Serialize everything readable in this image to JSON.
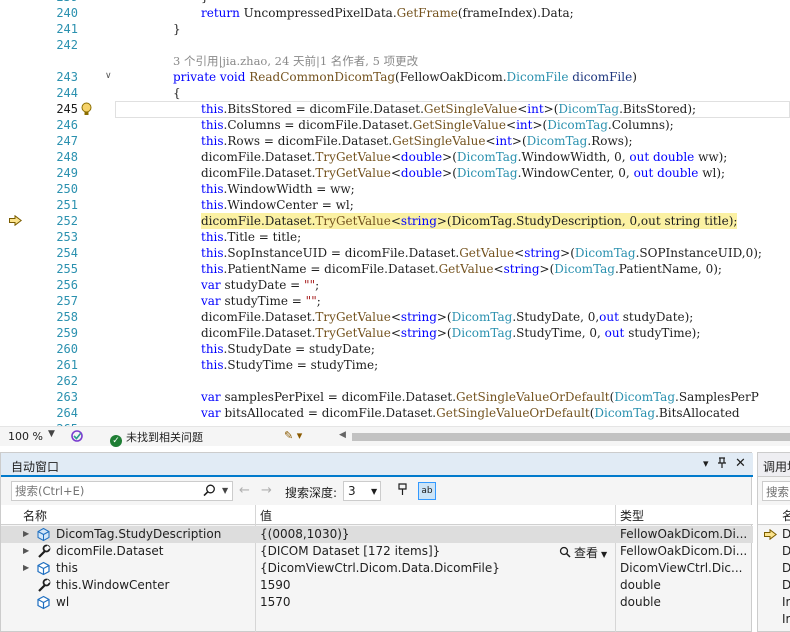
{
  "editor": {
    "lines": [
      {
        "n": "239",
        "indent": 3,
        "tokens": [
          [
            "p",
            "}"
          ]
        ]
      },
      {
        "n": "240",
        "indent": 3,
        "tokens": [
          [
            "kw",
            "return "
          ],
          [
            "p",
            "UncompressedPixelData."
          ],
          [
            "m",
            "GetFrame"
          ],
          [
            "p",
            "(frameIndex).Data;"
          ]
        ]
      },
      {
        "n": "241",
        "indent": 2,
        "tokens": [
          [
            "p",
            "}"
          ]
        ]
      },
      {
        "n": "242",
        "indent": 0,
        "tokens": []
      },
      {
        "n": "243",
        "indent": 2,
        "tokens": [
          [
            "kw",
            "private void "
          ],
          [
            "m",
            "ReadCommonDicomTag"
          ],
          [
            "p",
            "(FellowOakDicom."
          ],
          [
            "ty",
            "DicomFile"
          ],
          [
            "p",
            " "
          ],
          [
            "pl",
            "dicomFile"
          ],
          [
            "p",
            ")"
          ]
        ]
      },
      {
        "n": "244",
        "indent": 2,
        "tokens": [
          [
            "p",
            "{"
          ]
        ]
      },
      {
        "n": "245",
        "indent": 3,
        "tokens": [
          [
            "kw",
            "this"
          ],
          [
            "p",
            ".BitsStored = dicomFile.Dataset."
          ],
          [
            "m",
            "GetSingleValue"
          ],
          [
            "p",
            "<"
          ],
          [
            "kw",
            "int"
          ],
          [
            "p",
            ">("
          ],
          [
            "ty",
            "DicomTag"
          ],
          [
            "p",
            ".BitsStored);"
          ]
        ]
      },
      {
        "n": "246",
        "indent": 3,
        "tokens": [
          [
            "kw",
            "this"
          ],
          [
            "p",
            ".Columns = dicomFile.Dataset."
          ],
          [
            "m",
            "GetSingleValue"
          ],
          [
            "p",
            "<"
          ],
          [
            "kw",
            "int"
          ],
          [
            "p",
            ">("
          ],
          [
            "ty",
            "DicomTag"
          ],
          [
            "p",
            ".Columns);"
          ]
        ]
      },
      {
        "n": "247",
        "indent": 3,
        "tokens": [
          [
            "kw",
            "this"
          ],
          [
            "p",
            ".Rows = dicomFile.Dataset."
          ],
          [
            "m",
            "GetSingleValue"
          ],
          [
            "p",
            "<"
          ],
          [
            "kw",
            "int"
          ],
          [
            "p",
            ">("
          ],
          [
            "ty",
            "DicomTag"
          ],
          [
            "p",
            ".Rows);"
          ]
        ]
      },
      {
        "n": "248",
        "indent": 3,
        "tokens": [
          [
            "p",
            "dicomFile.Dataset."
          ],
          [
            "m",
            "TryGetValue"
          ],
          [
            "p",
            "<"
          ],
          [
            "kw",
            "double"
          ],
          [
            "p",
            ">("
          ],
          [
            "ty",
            "DicomTag"
          ],
          [
            "p",
            ".WindowWidth, 0, "
          ],
          [
            "kw",
            "out double "
          ],
          [
            "p",
            "ww);"
          ]
        ]
      },
      {
        "n": "249",
        "indent": 3,
        "tokens": [
          [
            "p",
            "dicomFile.Dataset."
          ],
          [
            "m",
            "TryGetValue"
          ],
          [
            "p",
            "<"
          ],
          [
            "kw",
            "double"
          ],
          [
            "p",
            ">("
          ],
          [
            "ty",
            "DicomTag"
          ],
          [
            "p",
            ".WindowCenter, 0, "
          ],
          [
            "kw",
            "out double "
          ],
          [
            "p",
            "wl);"
          ]
        ]
      },
      {
        "n": "250",
        "indent": 3,
        "tokens": [
          [
            "kw",
            "this"
          ],
          [
            "p",
            ".WindowWidth = ww;"
          ]
        ]
      },
      {
        "n": "251",
        "indent": 3,
        "tokens": [
          [
            "kw",
            "this"
          ],
          [
            "p",
            ".WindowCenter = wl;"
          ]
        ]
      },
      {
        "n": "252",
        "indent": 3,
        "highlight": true,
        "tokens": [
          [
            "p",
            "dicomFile.Dataset."
          ],
          [
            "m",
            "TryGetValue"
          ],
          [
            "p",
            "<"
          ],
          [
            "kw",
            "string"
          ],
          [
            "p",
            ">(DicomTag."
          ],
          [
            "p",
            "StudyDescription, 0,out string title);"
          ]
        ]
      },
      {
        "n": "253",
        "indent": 3,
        "tokens": [
          [
            "kw",
            "this"
          ],
          [
            "p",
            ".Title = title;"
          ]
        ]
      },
      {
        "n": "254",
        "indent": 3,
        "tokens": [
          [
            "kw",
            "this"
          ],
          [
            "p",
            ".SopInstanceUID = dicomFile.Dataset."
          ],
          [
            "m",
            "GetValue"
          ],
          [
            "p",
            "<"
          ],
          [
            "kw",
            "string"
          ],
          [
            "p",
            ">("
          ],
          [
            "ty",
            "DicomTag"
          ],
          [
            "p",
            ".SOPInstanceUID,0);"
          ]
        ]
      },
      {
        "n": "255",
        "indent": 3,
        "tokens": [
          [
            "kw",
            "this"
          ],
          [
            "p",
            ".PatientName = dicomFile.Dataset."
          ],
          [
            "m",
            "GetValue"
          ],
          [
            "p",
            "<"
          ],
          [
            "kw",
            "string"
          ],
          [
            "p",
            ">("
          ],
          [
            "ty",
            "DicomTag"
          ],
          [
            "p",
            ".PatientName, 0);"
          ]
        ]
      },
      {
        "n": "256",
        "indent": 3,
        "tokens": [
          [
            "kw",
            "var "
          ],
          [
            "p",
            "studyDate = "
          ],
          [
            "st",
            "\"\""
          ],
          [
            "p",
            ";"
          ]
        ]
      },
      {
        "n": "257",
        "indent": 3,
        "tokens": [
          [
            "kw",
            "var "
          ],
          [
            "p",
            "studyTime = "
          ],
          [
            "st",
            "\"\""
          ],
          [
            "p",
            ";"
          ]
        ]
      },
      {
        "n": "258",
        "indent": 3,
        "tokens": [
          [
            "p",
            "dicomFile.Dataset."
          ],
          [
            "m",
            "TryGetValue"
          ],
          [
            "p",
            "<"
          ],
          [
            "kw",
            "string"
          ],
          [
            "p",
            ">("
          ],
          [
            "ty",
            "DicomTag"
          ],
          [
            "p",
            ".StudyDate, 0,"
          ],
          [
            "kw",
            "out "
          ],
          [
            "p",
            "studyDate);"
          ]
        ]
      },
      {
        "n": "259",
        "indent": 3,
        "tokens": [
          [
            "p",
            "dicomFile.Dataset."
          ],
          [
            "m",
            "TryGetValue"
          ],
          [
            "p",
            "<"
          ],
          [
            "kw",
            "string"
          ],
          [
            "p",
            ">("
          ],
          [
            "ty",
            "DicomTag"
          ],
          [
            "p",
            ".StudyTime, 0, "
          ],
          [
            "kw",
            "out "
          ],
          [
            "p",
            "studyTime);"
          ]
        ]
      },
      {
        "n": "260",
        "indent": 3,
        "tokens": [
          [
            "kw",
            "this"
          ],
          [
            "p",
            ".StudyDate = studyDate;"
          ]
        ]
      },
      {
        "n": "261",
        "indent": 3,
        "tokens": [
          [
            "kw",
            "this"
          ],
          [
            "p",
            ".StudyTime = studyTime;"
          ]
        ]
      },
      {
        "n": "262",
        "indent": 0,
        "tokens": []
      },
      {
        "n": "263",
        "indent": 3,
        "tokens": [
          [
            "kw",
            "var "
          ],
          [
            "p",
            "samplesPerPixel = dicomFile.Dataset."
          ],
          [
            "m",
            "GetSingleValueOrDefault"
          ],
          [
            "p",
            "("
          ],
          [
            "ty",
            "DicomTag"
          ],
          [
            "p",
            ".SamplesPerP"
          ]
        ]
      },
      {
        "n": "264",
        "indent": 3,
        "tokens": [
          [
            "kw",
            "var "
          ],
          [
            "p",
            "bitsAllocated = dicomFile.Dataset."
          ],
          [
            "m",
            "GetSingleValueOrDefault"
          ],
          [
            "p",
            "("
          ],
          [
            "ty",
            "DicomTag"
          ],
          [
            "p",
            ".BitsAllocated"
          ]
        ]
      },
      {
        "n": "265",
        "indent": 3,
        "tokens": []
      }
    ],
    "codelens": "3 个引用|jia.zhao, 24 天前|1 名作者, 5 项更改",
    "current_line": "245",
    "execution_line": "252"
  },
  "editor_status": {
    "zoom": "100 %",
    "issues": "未找到相关问题"
  },
  "autos": {
    "title": "自动窗口",
    "search_placeholder": "搜索(Ctrl+E)",
    "depth_label": "搜索深度:",
    "depth_value": "3",
    "columns": [
      "名称",
      "值",
      "类型"
    ],
    "rows": [
      {
        "name": "DicomTag.StudyDescription",
        "value": "{(0008,1030)}",
        "type": "FellowOakDicom.Di...",
        "icon": "field-icon",
        "expandable": true,
        "selected": true
      },
      {
        "name": "dicomFile.Dataset",
        "value": "{DICOM Dataset [172 items]}",
        "type": "FellowOakDicom.Di...",
        "icon": "wrench-property-icon",
        "expandable": true,
        "viewer": "查看"
      },
      {
        "name": "this",
        "value": "{DicomViewCtrl.Dicom.Data.DicomFile}",
        "type": "DicomViewCtrl.Dic...",
        "icon": "local-variable-icon",
        "expandable": true
      },
      {
        "name": "this.WindowCenter",
        "value": "1590",
        "type": "double",
        "icon": "wrench-property-icon",
        "expandable": false
      },
      {
        "name": "wl",
        "value": "1570",
        "type": "double",
        "icon": "local-variable-icon",
        "expandable": false
      }
    ]
  },
  "callstack": {
    "title": "调用堆栈",
    "search_placeholder": "搜索(Ctrl+E)",
    "column": "名称",
    "rows": [
      "Di",
      "Di",
      "Di",
      "Di",
      "Im",
      "Im"
    ]
  }
}
